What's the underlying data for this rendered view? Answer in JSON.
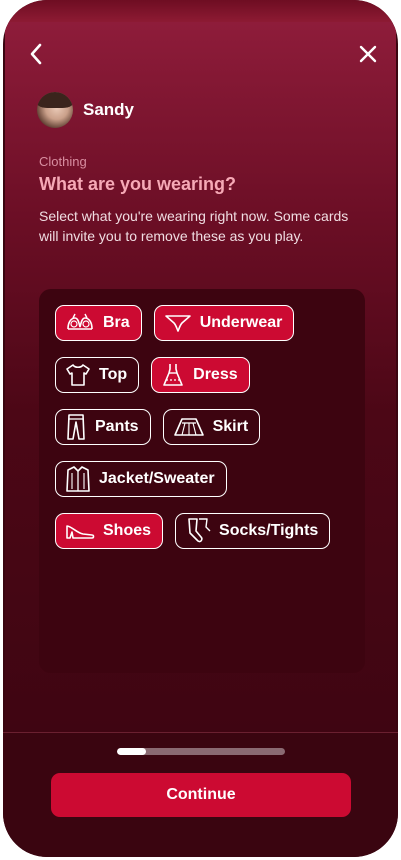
{
  "header": {
    "back_icon": "chevron-left-icon",
    "close_icon": "close-icon"
  },
  "user": {
    "name": "Sandy"
  },
  "section": {
    "label": "Clothing",
    "heading": "What are you wearing?",
    "description": "Select what you're wearing right now. Some cards will invite you to remove these as you play."
  },
  "clothing_items": [
    {
      "label": "Bra",
      "icon": "bra-icon",
      "selected": true
    },
    {
      "label": "Underwear",
      "icon": "underwear-icon",
      "selected": true
    },
    {
      "label": "Top",
      "icon": "top-icon",
      "selected": false
    },
    {
      "label": "Dress",
      "icon": "dress-icon",
      "selected": true
    },
    {
      "label": "Pants",
      "icon": "pants-icon",
      "selected": false
    },
    {
      "label": "Skirt",
      "icon": "skirt-icon",
      "selected": false
    },
    {
      "label": "Jacket/Sweater",
      "icon": "jacket-icon",
      "selected": false
    },
    {
      "label": "Shoes",
      "icon": "shoes-icon",
      "selected": true
    },
    {
      "label": "Socks/Tights",
      "icon": "socks-icon",
      "selected": false
    }
  ],
  "progress": {
    "fraction": 0.17
  },
  "footer": {
    "continue_label": "Continue"
  },
  "colors": {
    "accent": "#cc0a32",
    "heading": "#f6a9b6",
    "panel": "#3d0410"
  }
}
